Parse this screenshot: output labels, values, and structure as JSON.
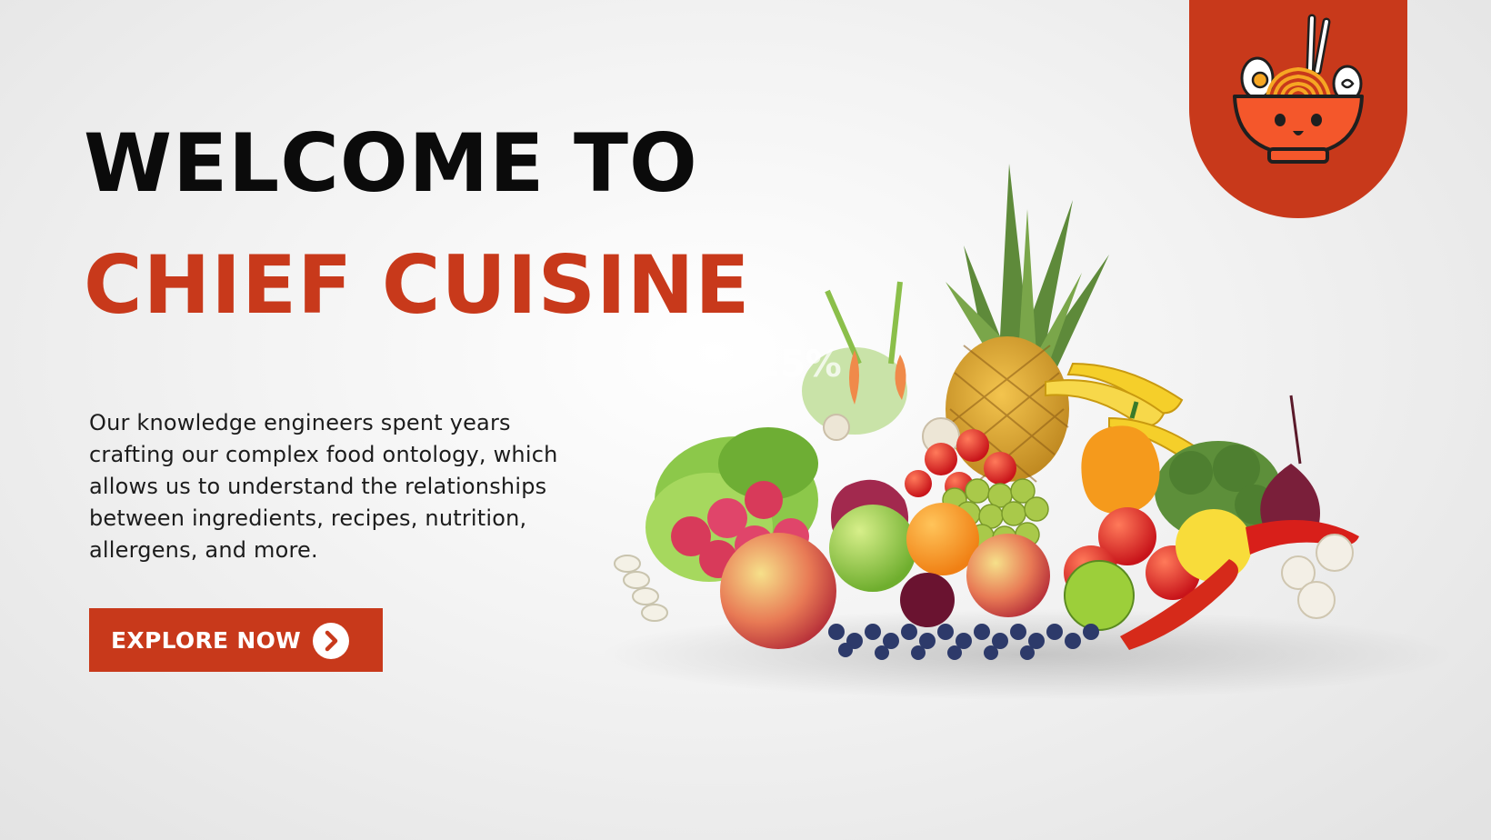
{
  "hero": {
    "title_line_1": "WELCOME TO",
    "title_line_2": "CHIEF CUISINE",
    "description": "Our knowledge engineers spent years crafting our complex food ontology, which allows us to understand the relationships between ingredients, recipes, nutrition, allergens, and more.",
    "cta_label": "EXPLORE NOW",
    "cta_icon": "chevron-right-circle-icon"
  },
  "logo": {
    "icon": "noodle-bowl-icon"
  },
  "image_overlay_text": "25%",
  "colors": {
    "accent": "#c8391b",
    "title_dark": "#0b0b0b",
    "background": "#f3f3f3"
  }
}
